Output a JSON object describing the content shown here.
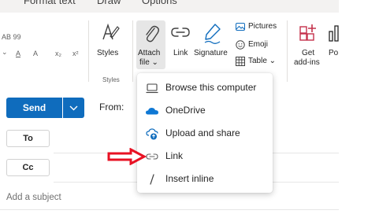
{
  "tabs": [
    "Format text",
    "Draw",
    "Options"
  ],
  "ribbon": {
    "format_glyph": "AB 99",
    "format_row2": [
      "A",
      "A",
      "x₂",
      "x²"
    ],
    "styles_label": "Styles",
    "styles_group_label": "Styles",
    "attach_label_line1": "Attach",
    "attach_label_line2": "file ⌄",
    "link_label": "Link",
    "signature_label": "Signature",
    "pictures_label": "Pictures",
    "emoji_label": "Emoji",
    "table_label": "Table ⌄",
    "addins_line1": "Get",
    "addins_line2": "add-ins",
    "cut_label": "Po"
  },
  "attach_menu": {
    "items": [
      {
        "label": "Browse this computer",
        "icon": "laptop-icon"
      },
      {
        "label": "OneDrive",
        "icon": "onedrive-cloud-icon"
      },
      {
        "label": "Upload and share",
        "icon": "cloud-upload-icon"
      },
      {
        "label": "Link",
        "icon": "link-icon"
      },
      {
        "label": "Insert inline",
        "icon": "slash-icon"
      }
    ]
  },
  "compose": {
    "send_label": "Send",
    "from_label": "From:",
    "to_label": "To",
    "cc_label": "Cc",
    "subject_placeholder": "Add a subject"
  },
  "colors": {
    "brand_blue": "#0f6cbd",
    "annotation_red": "#e81123",
    "onedrive_blue": "#0f78d4"
  }
}
